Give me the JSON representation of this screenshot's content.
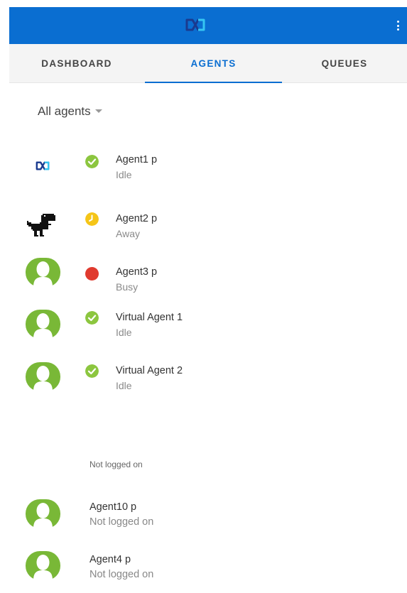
{
  "tabs": [
    {
      "label": "DASHBOARD"
    },
    {
      "label": "AGENTS"
    },
    {
      "label": "QUEUES"
    }
  ],
  "active_tab": "AGENTS",
  "filter": {
    "label": "All agents"
  },
  "agents": [
    {
      "name": "Agent1 p",
      "status": "Idle",
      "avatar": "logo-icon",
      "status_icon": "check-icon",
      "status_color": "#8cc63f"
    },
    {
      "name": "Agent2 p",
      "status": "Away",
      "avatar": "dinosaur-icon",
      "status_icon": "clock-icon",
      "status_color": "#f5c518"
    },
    {
      "name": "Agent3 p",
      "status": "Busy",
      "avatar": "default-user-icon",
      "status_icon": "dot-icon",
      "status_color": "#e03a2e"
    },
    {
      "name": "Virtual Agent 1",
      "status": "Idle",
      "avatar": "default-user-icon",
      "status_icon": "check-icon",
      "status_color": "#8cc63f"
    },
    {
      "name": "Virtual Agent 2",
      "status": "Idle",
      "avatar": "default-user-icon",
      "status_icon": "check-icon",
      "status_color": "#8cc63f"
    }
  ],
  "offline_section": {
    "label": "Not logged on",
    "agents": [
      {
        "name": "Agent10 p",
        "status": "Not logged on",
        "avatar": "default-user-icon"
      },
      {
        "name": "Agent4 p",
        "status": "Not logged on",
        "avatar": "default-user-icon"
      }
    ]
  },
  "colors": {
    "brand": "#0a6ed1",
    "avatar_green": "#79b837",
    "idle": "#8cc63f",
    "away": "#f5c518",
    "busy": "#e03a2e"
  }
}
